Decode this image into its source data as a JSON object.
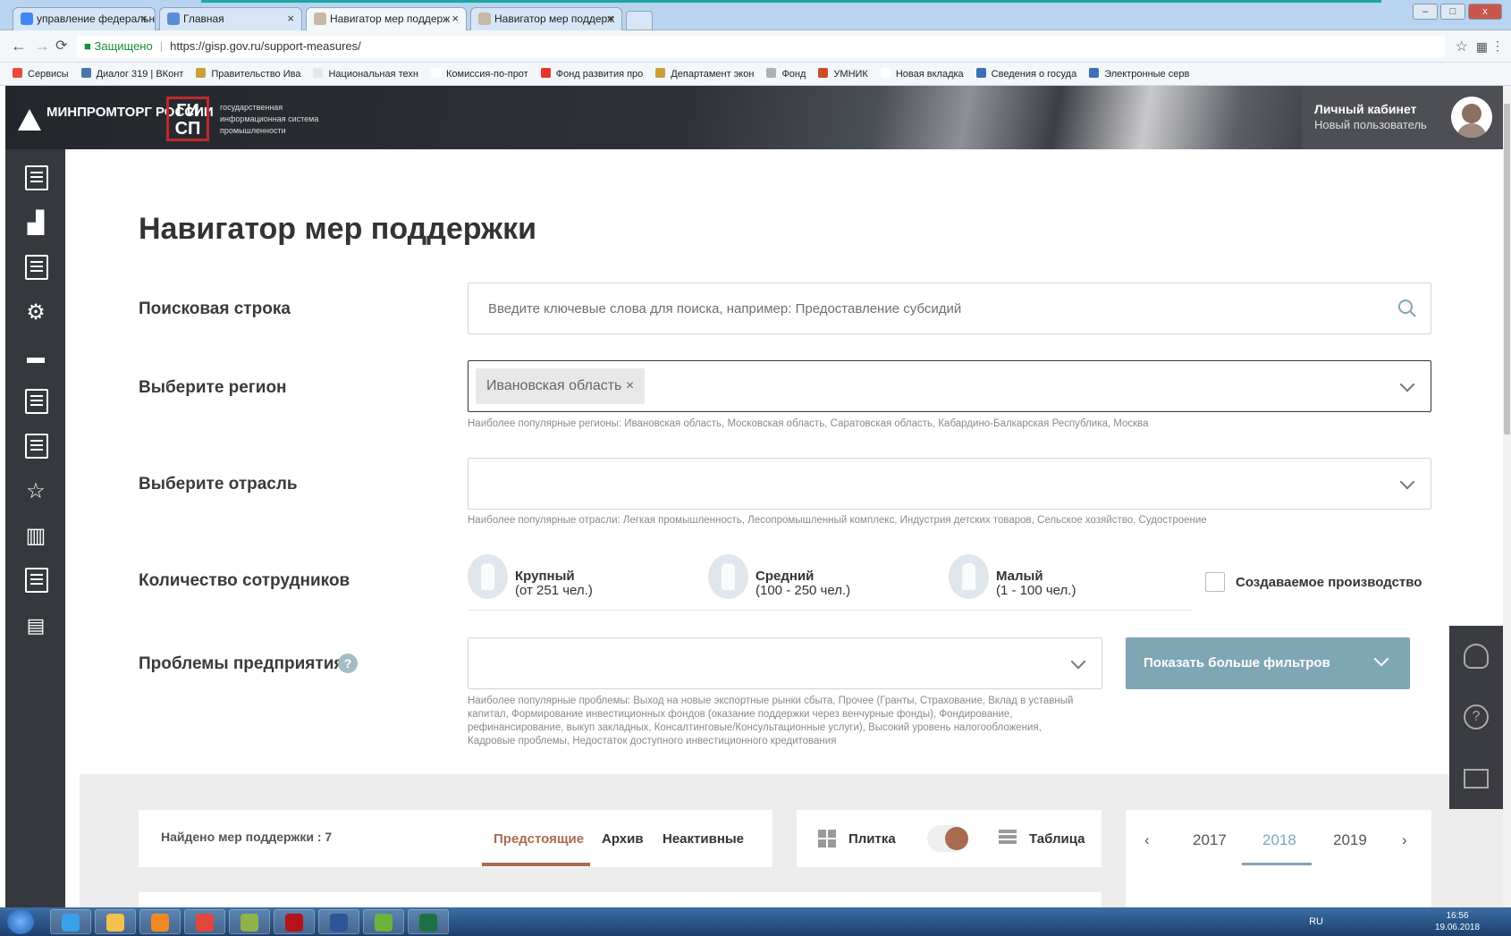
{
  "browser": {
    "tabs": [
      {
        "label": "управление федеральн",
        "icon": "google-icon",
        "color": "#4285f4"
      },
      {
        "label": "Главная",
        "icon": "page-icon",
        "color": "#5a8dd6"
      },
      {
        "label": "Навигатор мер поддерж",
        "icon": "gisp-icon",
        "color": "#c9b8a6"
      },
      {
        "label": "Навигатор мер поддерж",
        "icon": "gisp-icon",
        "color": "#c9b8a6"
      }
    ],
    "close_glyph": "×",
    "window_buttons": [
      "–",
      "□",
      "x"
    ],
    "secure_label": "Защищено",
    "url": "https://gisp.gov.ru/support-measures/",
    "bookmarks": [
      {
        "label": "Сервисы",
        "color": "#e84b3c"
      },
      {
        "label": "Диалог 319 | ВКонт",
        "color": "#4a76a8"
      },
      {
        "label": "Правительство Ива",
        "color": "#c8a03c"
      },
      {
        "label": "Национальная техн",
        "color": "#e6e6e6"
      },
      {
        "label": "Комиссия-по-прот",
        "color": "#ffffff"
      },
      {
        "label": "Фонд развития про",
        "color": "#e8352e"
      },
      {
        "label": "Департамент экон",
        "color": "#c8a03c"
      },
      {
        "label": "Фонд",
        "color": "#b0b0b0"
      },
      {
        "label": "УМНИК",
        "color": "#d14a2a"
      },
      {
        "label": "Новая вкладка",
        "color": "#ffffff"
      },
      {
        "label": "Сведения о госуда",
        "color": "#3f6fb5"
      },
      {
        "label": "Электронные серв",
        "color": "#3f6fb5"
      }
    ]
  },
  "site": {
    "logo_text": "МИНПРОМТОРГ РОССИИ",
    "gisp_logo": "ГИ СП",
    "gisp_caption": "государственная информационная система промышленности",
    "cabinet_title": "Личный кабинет",
    "cabinet_user": "Новый пользователь"
  },
  "page": {
    "title": "Навигатор мер поддержки",
    "search": {
      "label": "Поисковая строка",
      "placeholder": "Введите ключевые слова для поиска, например: Предоставление субсидий"
    },
    "region": {
      "label": "Выберите регион",
      "selected": "Ивановская область ×",
      "hint": "Наиболее популярные регионы: Ивановская область, Московская область, Саратовская область, Кабардино-Балкарская Республика, Москва"
    },
    "industry": {
      "label": "Выберите отрасль",
      "hint": "Наиболее популярные отрасли: Легкая промышленность, Лесопромышленный комплекс, Индустрия детских товаров, Сельское хозяйство, Судостроение"
    },
    "employees": {
      "label": "Количество сотрудников",
      "options": [
        {
          "name": "Крупный",
          "sub": "(от 251 чел.)"
        },
        {
          "name": "Средний",
          "sub": "(100 - 250 чел.)"
        },
        {
          "name": "Малый",
          "sub": "(1 - 100 чел.)"
        }
      ],
      "new_production": "Создаваемое производство"
    },
    "problems": {
      "label": "Проблемы предприятия",
      "help": "?",
      "hint_lines": [
        "Наиболее популярные проблемы: Выход на новые экспортные рынки сбыта, Прочее (Гранты, Страхование, Вклад в уставный",
        "капитал, Формирование инвестиционных фондов (оказание поддержки через венчурные фонды), Фондирование,",
        "рефинансирование, выкуп закладных, Консалтинговые/Консультационные услуги), Высокий уровень налогообложения,",
        "Кадровые проблемы, Недостаток доступного инвестиционного кредитования"
      ]
    },
    "more_filters": "Показать больше фильтров",
    "results": {
      "found": "Найдено мер поддержки : 7",
      "tabs": [
        "Предстоящие",
        "Архив",
        "Неактивные"
      ],
      "view_tile": "Плитка",
      "view_table": "Таблица",
      "years": [
        "2017",
        "2018",
        "2019"
      ],
      "selected_year": "2018"
    }
  },
  "taskbar": {
    "apps": [
      {
        "name": "ie",
        "color": "#3aa0e8"
      },
      {
        "name": "explorer",
        "color": "#f2c14e"
      },
      {
        "name": "media",
        "color": "#f08a24"
      },
      {
        "name": "chrome",
        "color": "#e0463a"
      },
      {
        "name": "files",
        "color": "#8fb24a"
      },
      {
        "name": "acrobat",
        "color": "#b5121b"
      },
      {
        "name": "word",
        "color": "#2b5797"
      },
      {
        "name": "app-a",
        "color": "#6ab43e"
      },
      {
        "name": "excel",
        "color": "#1e7145"
      }
    ],
    "lang": "RU",
    "time": "16:56",
    "date": "19.06.2018"
  },
  "colors": {
    "accent": "#a86b50",
    "filter_button": "#7fa6b4",
    "teal_banner": "#1aa8a0"
  }
}
